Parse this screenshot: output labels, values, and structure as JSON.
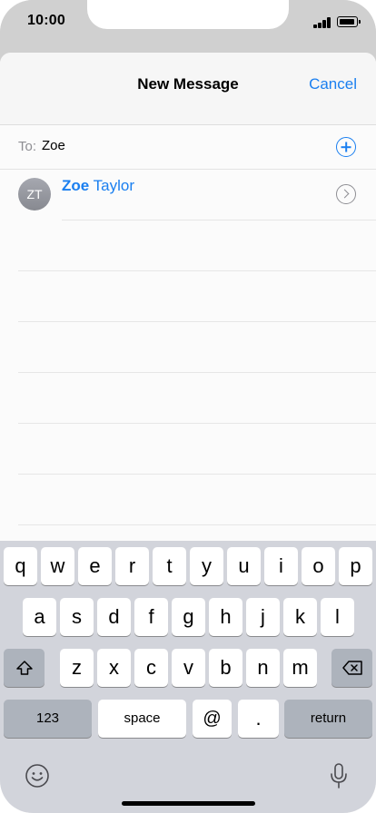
{
  "status_bar": {
    "time": "10:00"
  },
  "nav": {
    "title": "New Message",
    "cancel": "Cancel"
  },
  "to_field": {
    "label": "To:",
    "value": "Zoe"
  },
  "suggestion": {
    "initials": "ZT",
    "match": "Zoe",
    "rest": " Taylor"
  },
  "keyboard": {
    "row1": [
      "q",
      "w",
      "e",
      "r",
      "t",
      "y",
      "u",
      "i",
      "o",
      "p"
    ],
    "row2": [
      "a",
      "s",
      "d",
      "f",
      "g",
      "h",
      "j",
      "k",
      "l"
    ],
    "row3": [
      "z",
      "x",
      "c",
      "v",
      "b",
      "n",
      "m"
    ],
    "numbers_label": "123",
    "space_label": "space",
    "at_label": "@",
    "dot_label": ".",
    "return_label": "return"
  },
  "icons": {
    "shift": "shift-icon",
    "delete": "delete-icon",
    "emoji": "emoji-icon",
    "mic": "microphone-icon",
    "add": "add-contact-icon",
    "info": "chevron-right-icon"
  },
  "colors": {
    "accent": "#1a7ff0",
    "keyboard_bg": "#d2d4db",
    "dark_key": "#adb3bc"
  }
}
